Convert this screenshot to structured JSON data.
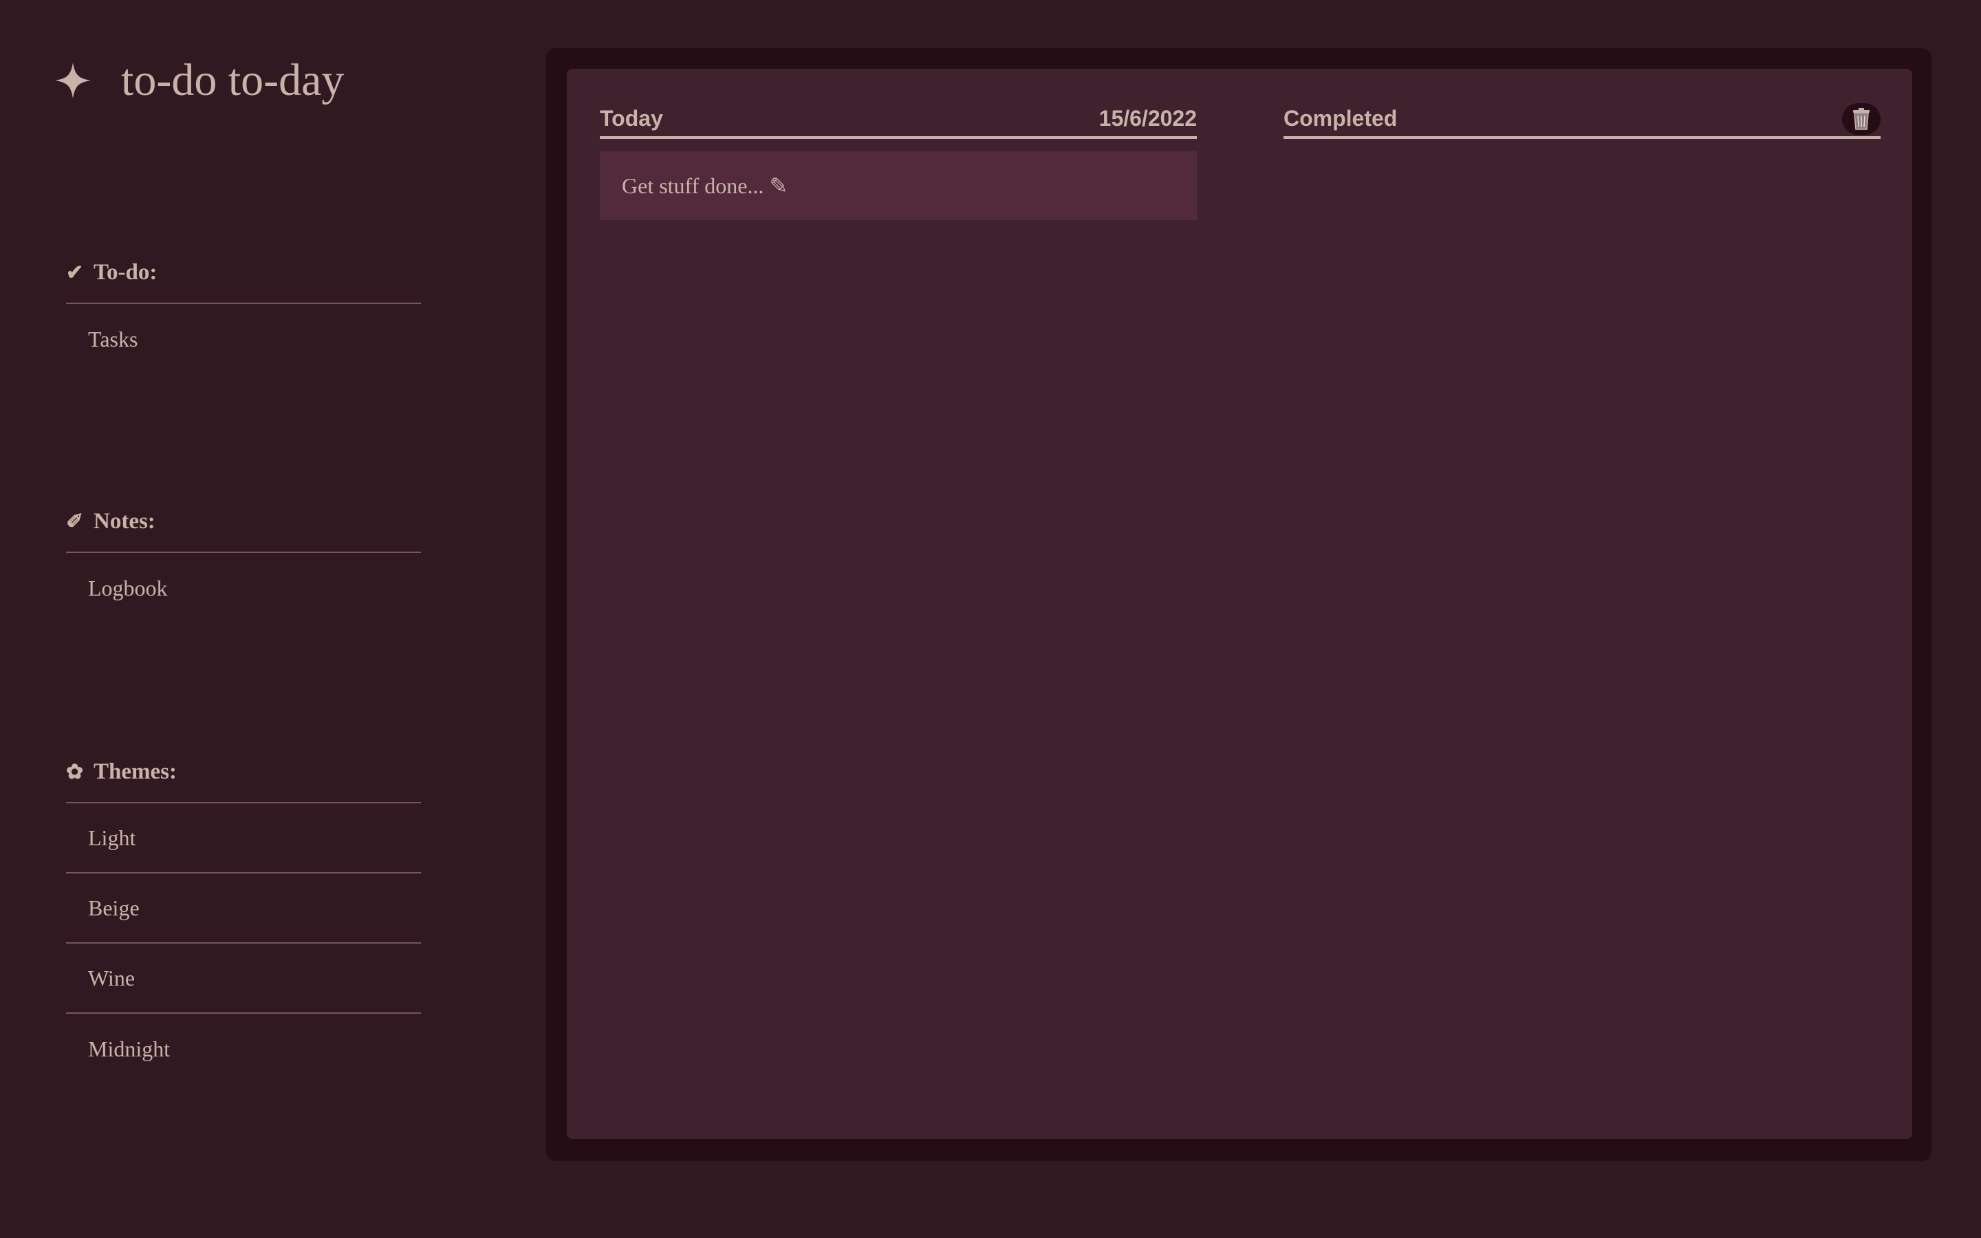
{
  "app": {
    "title": "to-do to-day",
    "logo_icon": "four-point-star-icon"
  },
  "sidebar": {
    "sections": [
      {
        "icon": "checkmark-icon",
        "icon_glyph": "✔",
        "label": "To-do:",
        "items": [
          "Tasks"
        ]
      },
      {
        "icon": "pencil-icon",
        "icon_glyph": "✐",
        "label": "Notes:",
        "items": [
          "Logbook"
        ]
      },
      {
        "icon": "flower-icon",
        "icon_glyph": "✿",
        "label": "Themes:",
        "items": [
          "Light",
          "Beige",
          "Wine",
          "Midnight"
        ]
      }
    ]
  },
  "main": {
    "today": {
      "heading": "Today",
      "date": "15/6/2022",
      "task_placeholder": "Get stuff done... ✎"
    },
    "completed": {
      "heading": "Completed",
      "clear_icon": "trash-can-icon"
    }
  },
  "colors": {
    "background": "#311921",
    "panel_outer": "#250d16",
    "panel_inner": "#3f222d",
    "task_item": "#53293c",
    "text": "#c9b3a9",
    "divider": "#76555d"
  }
}
